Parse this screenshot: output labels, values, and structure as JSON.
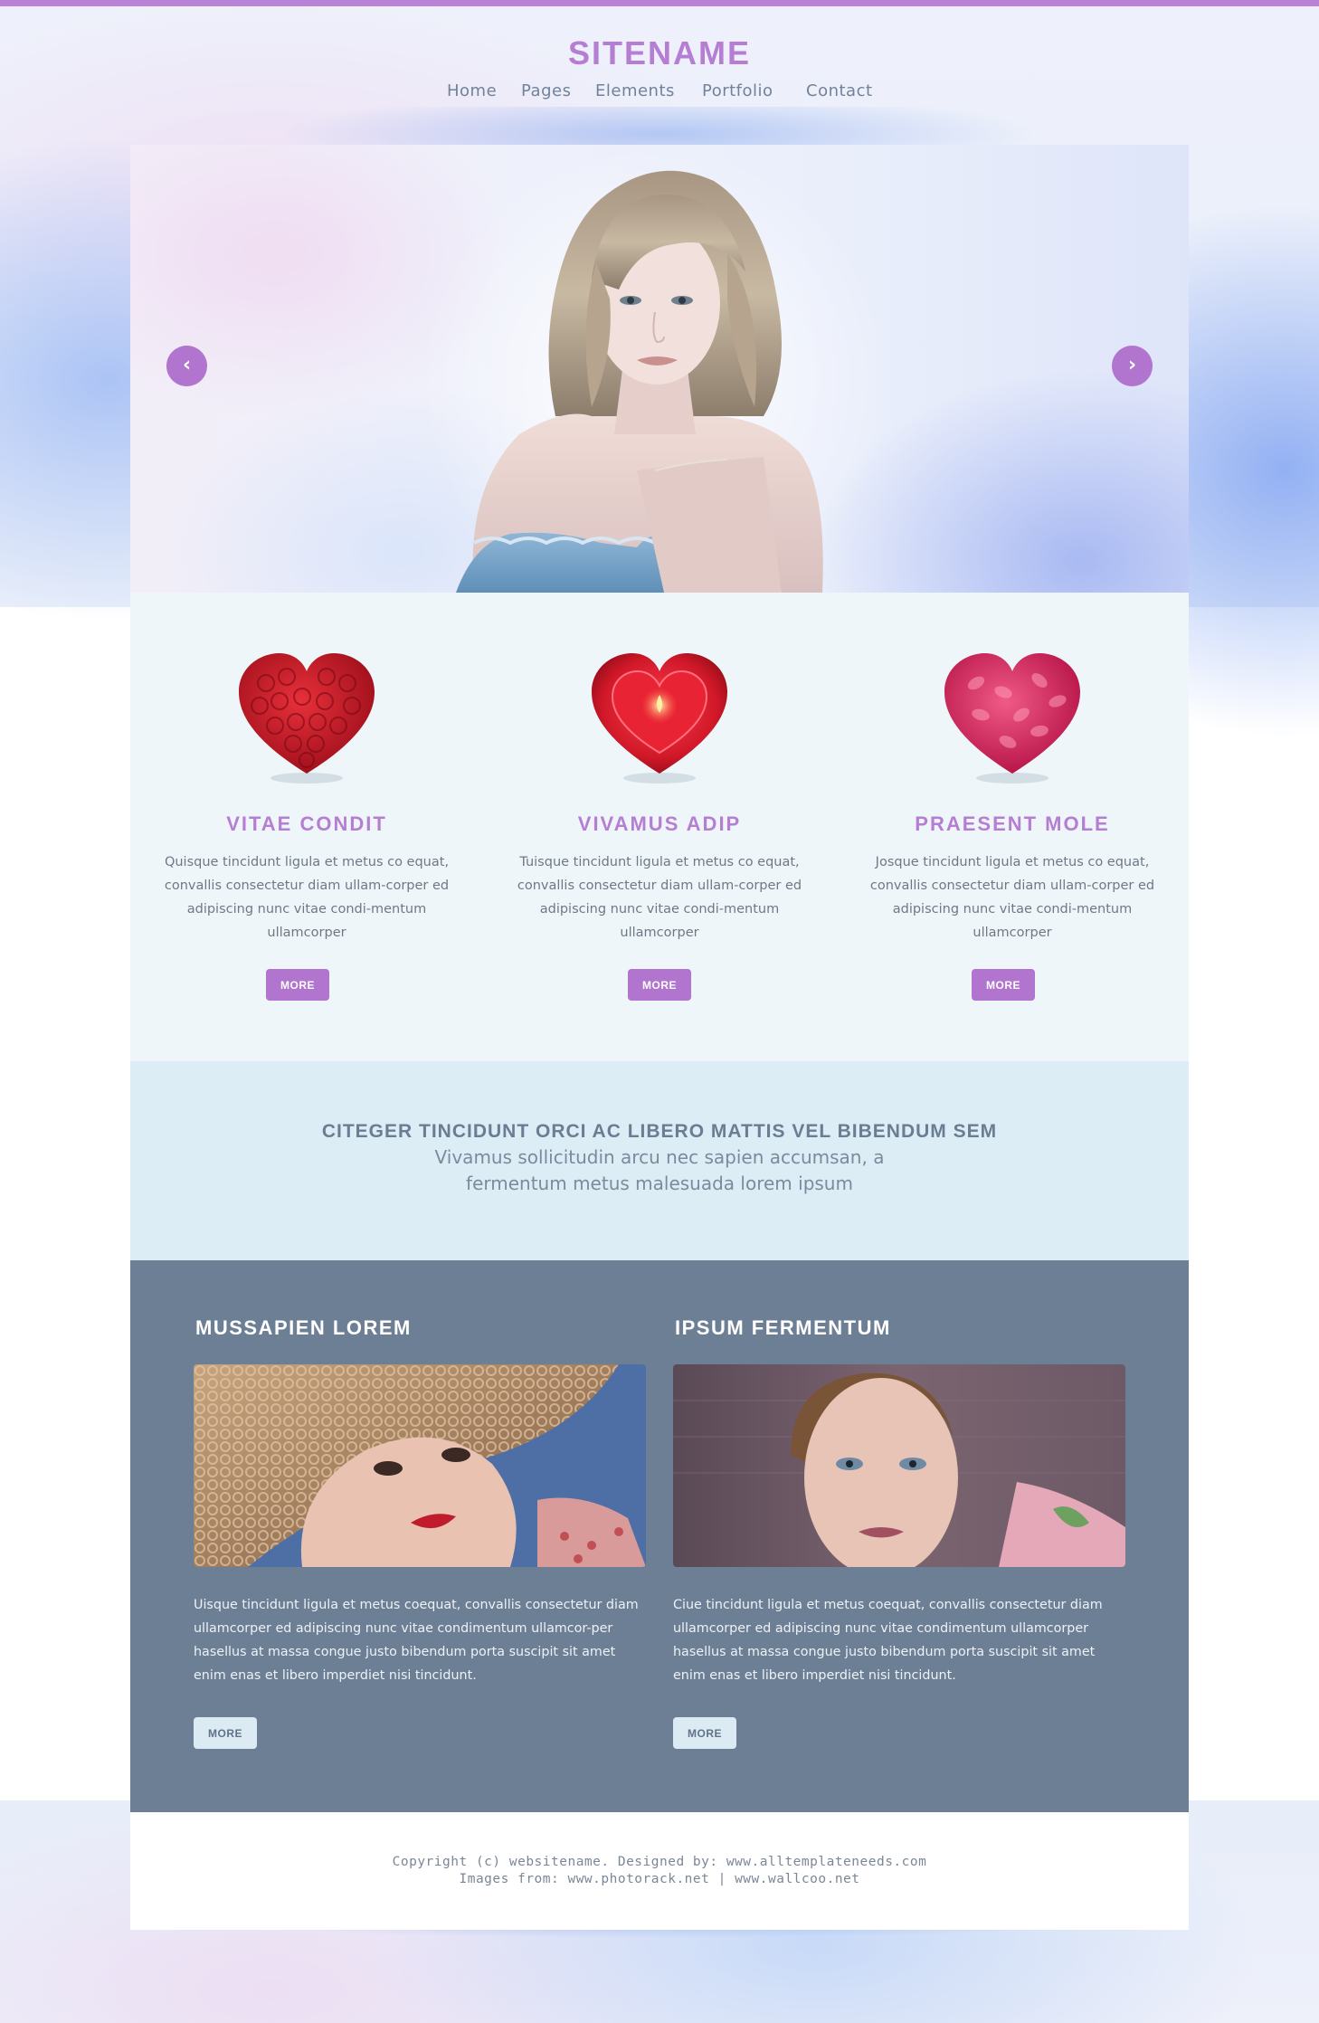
{
  "header": {
    "logo": "SITENAME",
    "nav": [
      "Home",
      "Pages",
      "Elements",
      "Portfolio",
      "Contact"
    ]
  },
  "slider": {
    "prev_icon": "chevron-left-icon",
    "next_icon": "chevron-right-icon",
    "prev_glyph": "‹",
    "next_glyph": "›",
    "image": "woman-portrait"
  },
  "features": [
    {
      "image": "rose-heart",
      "title": "VITAE CONDIT",
      "text": "Quisque tincidunt ligula et metus co equat, convallis consectetur diam ullam-corper ed adipiscing nunc vitae condi-mentum ullamcorper",
      "button": "MORE"
    },
    {
      "image": "candle-heart",
      "title": "VIVAMUS ADIP",
      "text": "Tuisque tincidunt ligula et metus co equat, convallis consectetur diam ullam-corper ed adipiscing nunc vitae condi-mentum ullamcorper",
      "button": "MORE"
    },
    {
      "image": "petal-heart",
      "title": "PRAESENT MOLE",
      "text": "Josque tincidunt ligula et metus co equat, convallis consectetur diam ullam-corper ed adipiscing nunc vitae condi-mentum ullamcorper",
      "button": "MORE"
    }
  ],
  "callout": {
    "heading": "CITEGER TINCIDUNT ORCI AC LIBERO MATTIS VEL BIBENDUM SEM",
    "subtext": "Vivamus sollicitudin arcu nec sapien accumsan, a fermentum metus malesuada lorem ipsum"
  },
  "articles": [
    {
      "title": "MUSSAPIEN LOREM",
      "image": "woman-straw-hat",
      "text": "Uisque tincidunt ligula et metus coequat, convallis consectetur diam ullamcorper ed adipiscing nunc vitae condimentum ullamcor-per hasellus at massa congue justo bibendum porta suscipit sit amet enim enas et libero imperdiet nisi tincidunt.",
      "button": "MORE"
    },
    {
      "title": "IPSUM FERMENTUM",
      "image": "woman-closeup",
      "text": "Ciue tincidunt ligula et metus coequat, convallis consectetur diam ullamcorper ed adipiscing nunc vitae condimentum ullamcorper hasellus at massa congue justo bibendum porta suscipit sit amet enim enas et libero imperdiet nisi tincidunt.",
      "button": "MORE"
    }
  ],
  "footer": {
    "copyright": "Copyright (c) websitename. Designed by:  www.alltemplateneeds.com",
    "images_from": "Images from: www.photorack.net  |  www.wallcoo.net"
  },
  "colors": {
    "accent": "#b57ed3",
    "button_purple": "#b174cf",
    "feature_bg": "#eef6f9",
    "callout_bg": "#dcedf5",
    "dark_section": "#6c7f95"
  }
}
